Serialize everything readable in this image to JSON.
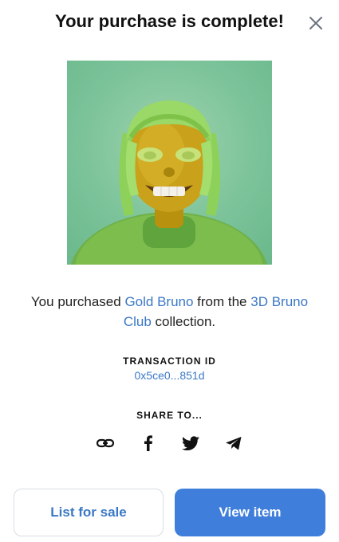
{
  "modal": {
    "title": "Your purchase is complete!",
    "close_icon": "close-icon"
  },
  "purchase": {
    "prefix": "You purchased ",
    "item_name": "Gold Bruno",
    "middle": " from the ",
    "collection_name": "3D Bruno Club",
    "suffix": " collection."
  },
  "transaction": {
    "label": "TRANSACTION ID",
    "id": "0x5ce0...851d"
  },
  "share": {
    "label": "SHARE TO...",
    "icons": [
      "link-icon",
      "facebook-icon",
      "twitter-icon",
      "telegram-icon"
    ]
  },
  "actions": {
    "list_for_sale": "List for sale",
    "view_item": "View item"
  },
  "colors": {
    "accent": "#3f7fdb",
    "link": "#3b78c6",
    "art_background": "#7cc39a",
    "art_figure": "#c9a11a"
  }
}
